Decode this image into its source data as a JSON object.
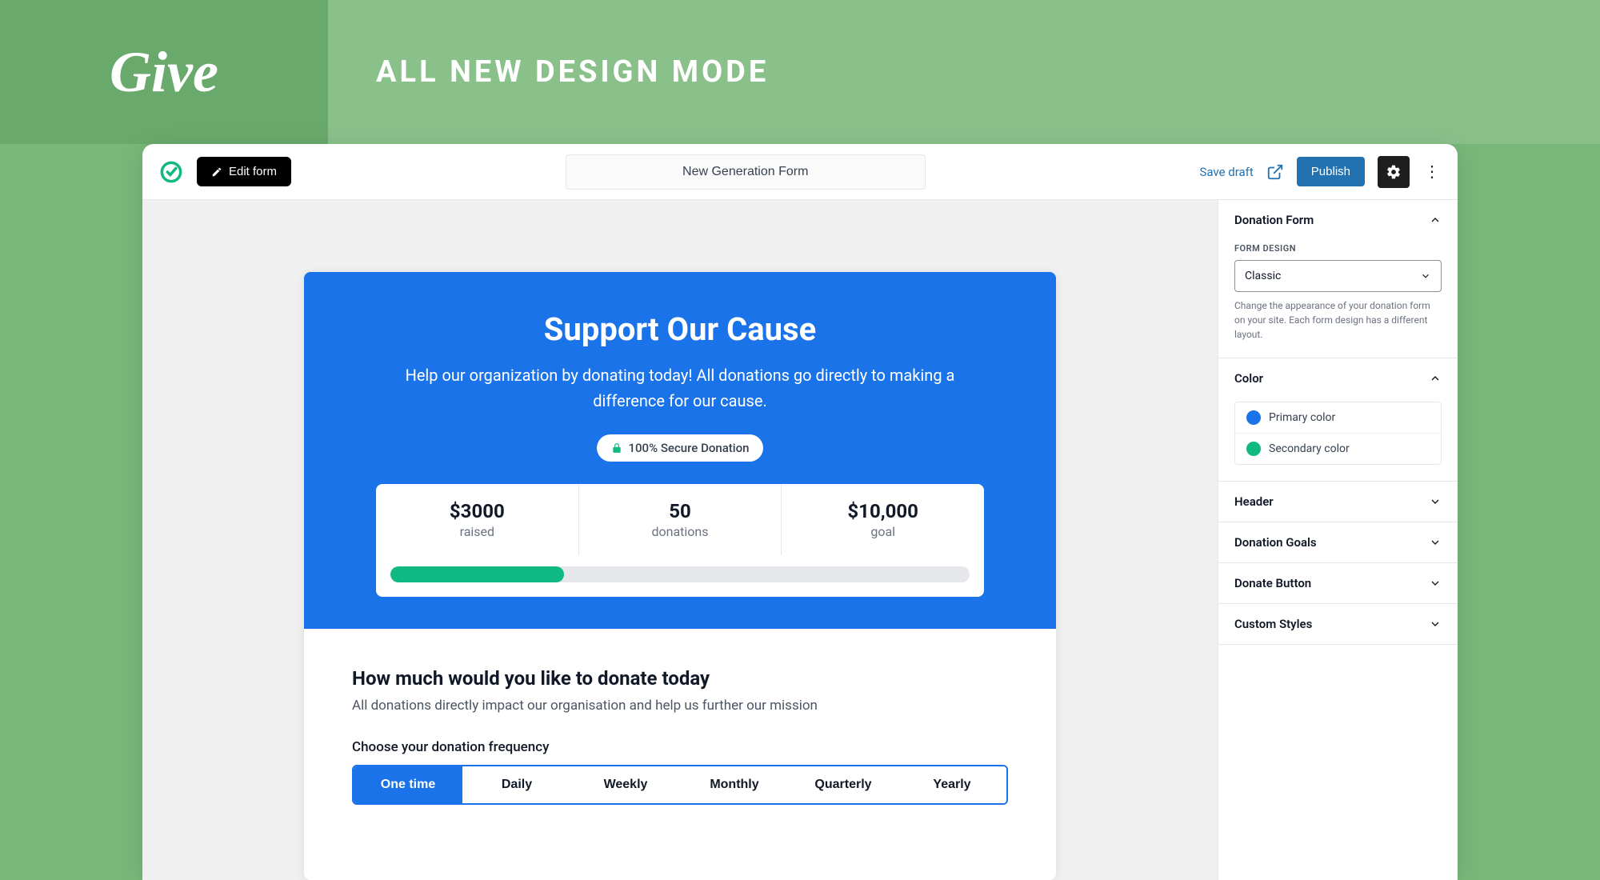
{
  "hero": {
    "title": "ALL NEW DESIGN MODE",
    "logo_text": "Give"
  },
  "toolbar": {
    "edit_form": "Edit form",
    "title": "New Generation Form",
    "save_draft": "Save draft",
    "publish": "Publish"
  },
  "form": {
    "title": "Support Our Cause",
    "subtitle": "Help our organization by donating today! All donations go directly to making a difference for our cause.",
    "secure_badge": "100% Secure Donation",
    "stats": {
      "raised_value": "$3000",
      "raised_label": "raised",
      "donations_value": "50",
      "donations_label": "donations",
      "goal_value": "$10,000",
      "goal_label": "goal",
      "progress_percent": 30
    },
    "amount_heading": "How much would you like to donate today",
    "amount_sub": "All donations directly impact our organisation and help us further our mission",
    "frequency_label": "Choose your donation frequency",
    "frequencies": [
      "One time",
      "Daily",
      "Weekly",
      "Monthly",
      "Quarterly",
      "Yearly"
    ]
  },
  "sidebar": {
    "donation_form": {
      "title": "Donation Form",
      "design_label": "FORM DESIGN",
      "design_value": "Classic",
      "help": "Change the appearance of your donation form on your site. Each form design has a different layout."
    },
    "color": {
      "title": "Color",
      "primary": "Primary color",
      "primary_hex": "#1a73e8",
      "secondary": "Secondary color",
      "secondary_hex": "#10b981"
    },
    "panels": {
      "header": "Header",
      "goals": "Donation Goals",
      "button": "Donate Button",
      "custom": "Custom Styles"
    }
  }
}
